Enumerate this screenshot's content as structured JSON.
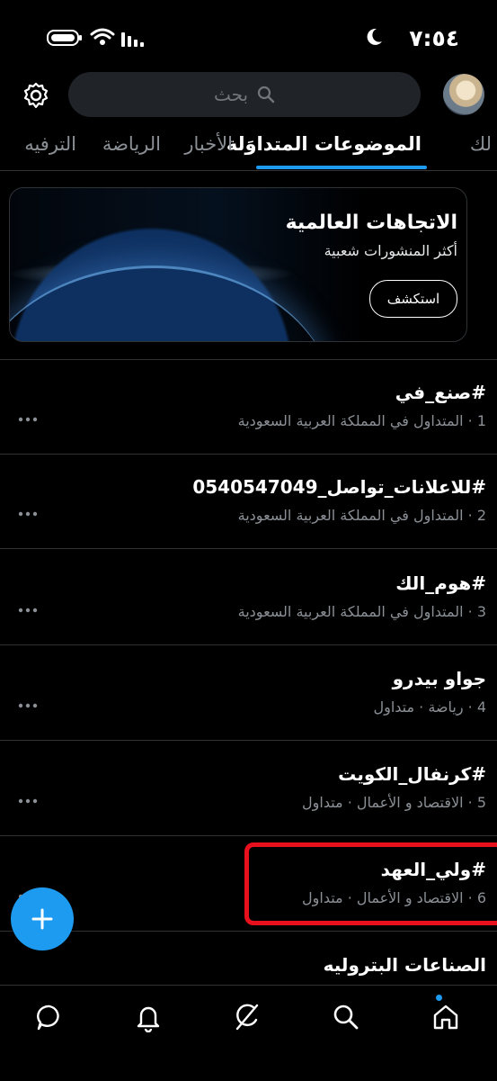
{
  "status_bar": {
    "time": "٧:٥٤"
  },
  "search": {
    "placeholder": "بحث"
  },
  "tabs": [
    {
      "label": "لك"
    },
    {
      "label": "الموضوعات المتداوَلة"
    },
    {
      "label": "الأخبار"
    },
    {
      "label": "الرياضة"
    },
    {
      "label": "الترفيه"
    }
  ],
  "explore_card": {
    "title": "الاتجاهات العالمية",
    "subtitle": "أكثر المنشورات شعبية",
    "button_label": "استكشف"
  },
  "trends": [
    {
      "title": "#صنع_في",
      "meta": "1 · المتداول في المملكة العربية السعودية"
    },
    {
      "title": "#للاعلانات_تواصل_0540547049",
      "meta": "2 · المتداول في المملكة العربية السعودية"
    },
    {
      "title": "#هوم_الك",
      "meta": "3 · المتداول في المملكة العربية السعودية"
    },
    {
      "title": "جواو بيدرو",
      "meta": "4 · رياضة · متداول"
    },
    {
      "title": "#كرنفال_الكويت",
      "meta": "5 · الاقتصاد و الأعمال · متداول"
    },
    {
      "title": "#ولي_العهد",
      "meta": "6 · الاقتصاد و الأعمال · متداول"
    },
    {
      "title": "الصناعات البتروليه",
      "meta": ""
    }
  ],
  "colors": {
    "accent": "#1d9bf0",
    "highlight": "#e8101c",
    "background": "#000000",
    "muted_text": "#8b9096"
  },
  "icons": {
    "status": [
      "battery-icon",
      "wifi-icon",
      "signal-icon",
      "moon-icon"
    ],
    "header": [
      "gear-icon",
      "search-icon"
    ],
    "nav": [
      "chat-icon",
      "bell-icon",
      "grok-icon",
      "search-icon",
      "home-icon"
    ]
  }
}
